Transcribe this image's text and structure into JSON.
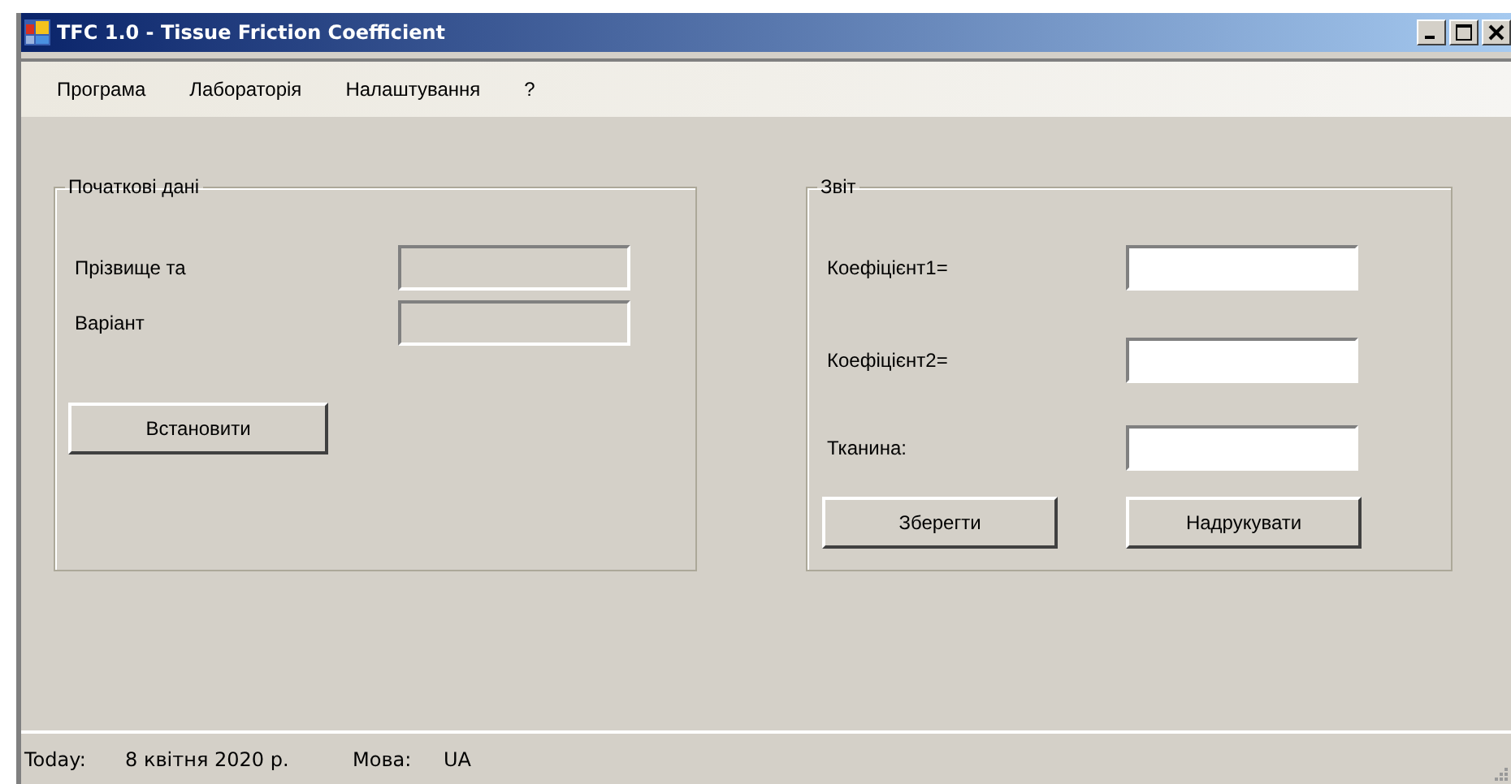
{
  "window": {
    "title": "TFC 1.0 - Tissue Friction Coefficient"
  },
  "menu": [
    "Програма",
    "Лабораторія",
    "Налаштування",
    "?"
  ],
  "initial_data": {
    "title": "Початкові дані",
    "fields": [
      {
        "label": "Прізвище та",
        "disabled": true
      },
      {
        "label": "Варіант",
        "disabled": true
      }
    ],
    "button": "Встановити"
  },
  "report": {
    "title": "Звіт",
    "fields": [
      {
        "label": "Коефіцієнт1=",
        "disabled": false
      },
      {
        "label": "Коефіцієнт2=",
        "disabled": false
      },
      {
        "label": "Тканина:",
        "disabled": false
      }
    ],
    "buttons": [
      "Зберегти",
      "Надрукувати"
    ]
  },
  "status_bar": {
    "today_label": "Today:",
    "date": "8 квітня 2020 р.",
    "language_label": "Мова:",
    "language": "UA"
  }
}
